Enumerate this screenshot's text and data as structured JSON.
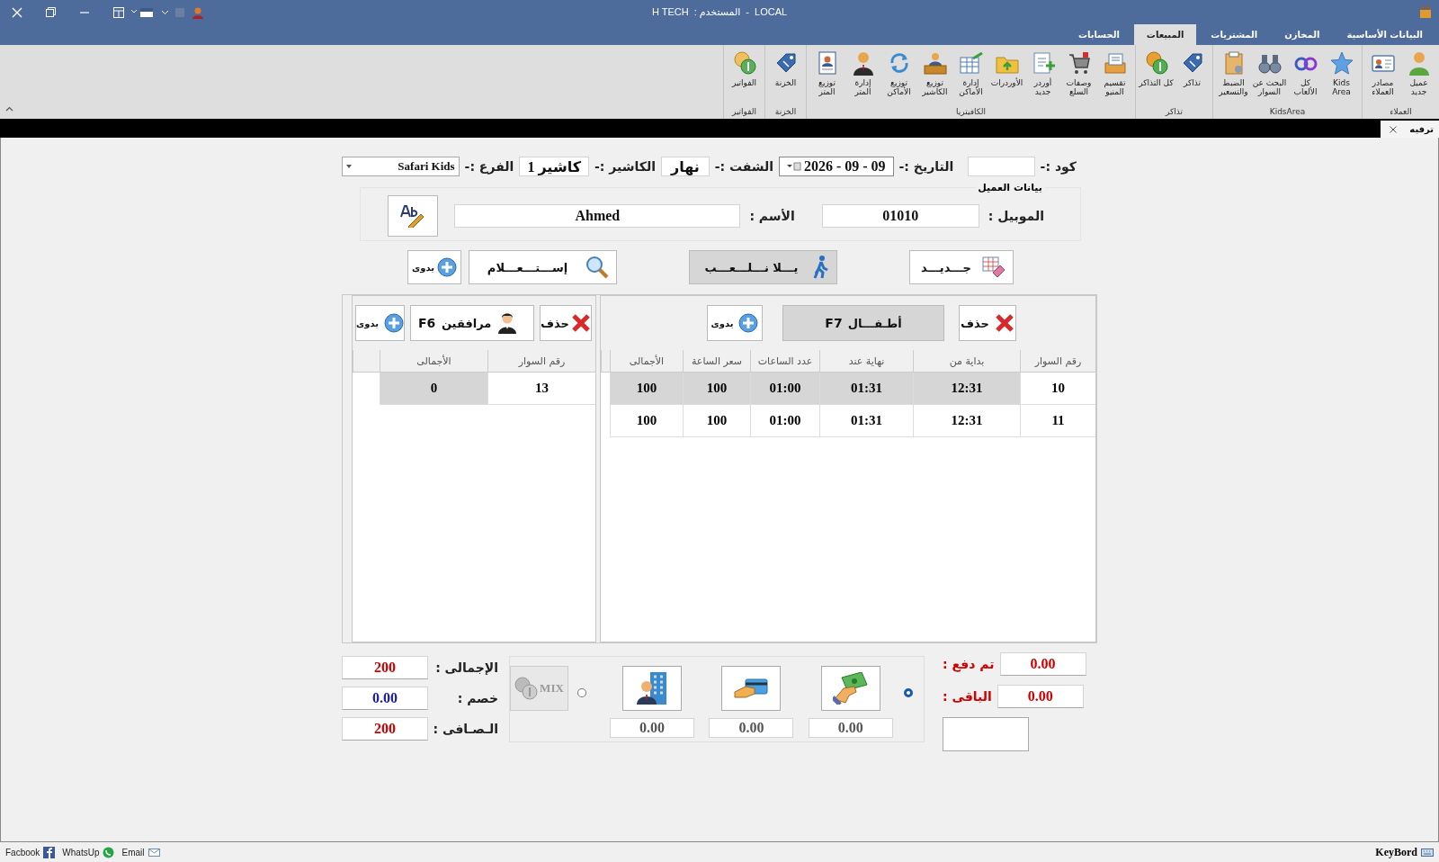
{
  "window": {
    "user": "H TECH",
    "user_label": "المستخدم :",
    "separator": "-",
    "server": "LOCAL"
  },
  "ribbon_tabs": [
    {
      "label": "البيانات الأساسية",
      "selected": false
    },
    {
      "label": "المخازن",
      "selected": false
    },
    {
      "label": "المشتريات",
      "selected": false
    },
    {
      "label": "المبيعات",
      "selected": true
    },
    {
      "label": "الحسابات",
      "selected": false
    }
  ],
  "ribbon_groups": [
    {
      "title": "العملاء",
      "items": [
        "عميل جديد",
        "مصادر العملاء"
      ]
    },
    {
      "title": "KidsArea",
      "items": [
        "Kids Area",
        "كل الألعاب",
        "البحث عن السوار",
        "الضبط والتسعير"
      ]
    },
    {
      "title": "تذاكر",
      "items": [
        "تذاكر",
        "كل التذاكر"
      ]
    },
    {
      "title": "الكافيتريا",
      "items": [
        "تقسيم المنيو",
        "وصفات السلع",
        "أوردر جديد",
        "الأوردرات",
        "إدارة الأماكن",
        "توزيع الكاشير",
        "توزيع الأماكن",
        "إدارة المتر",
        "توزيع المتر"
      ]
    },
    {
      "title": "الخزنة",
      "items": [
        "الخزنة"
      ]
    },
    {
      "title": "الفواتير",
      "items": [
        "الفواتير"
      ]
    }
  ],
  "document_tab": {
    "label": "ترفيه"
  },
  "header": {
    "code_label": "كود :-",
    "date_label": "التاريخ :-",
    "date": "2026 - 09 - 09",
    "shift_label": "الشفت :-",
    "shift": "نهار",
    "cashier_label": "الكاشير :-",
    "cashier": "كاشير 1",
    "branch_label": "الفرع :-",
    "branch": "Safari Kids"
  },
  "customer": {
    "title": "بيانات العميل",
    "mobile_label": "الموبيل :",
    "mobile": "01010",
    "name_label": "الأسم :",
    "name": "Ahmed"
  },
  "actions": [
    {
      "kind": "new",
      "label": "جـــديـــد"
    },
    {
      "kind": "play",
      "label": "يـــلا نـــلـــعـــب"
    },
    {
      "kind": "inquiry",
      "label": "إســـتـــعـــلام"
    },
    {
      "kind": "manual",
      "label": "يدوى"
    }
  ],
  "children_panel": {
    "delete": "حذف",
    "title": "أطـفـــال",
    "hotkey": "F7",
    "manual": "يدوى",
    "columns": [
      "رقم السوار",
      "بداية من",
      "نهاية عند",
      "عدد الساعات",
      "سعر الساعة",
      "الأجمالى"
    ],
    "rows": [
      {
        "selected": true,
        "cells": [
          "10",
          "12:31",
          "01:31",
          "01:00",
          "100",
          "100"
        ]
      },
      {
        "selected": false,
        "cells": [
          "11",
          "12:31",
          "01:31",
          "01:00",
          "100",
          "100"
        ]
      }
    ]
  },
  "companions_panel": {
    "delete": "حذف",
    "title": "مرافقين",
    "hotkey": "F6",
    "manual": "يدوى",
    "columns": [
      "رقم السوار",
      "الأجمالى"
    ],
    "rows": [
      {
        "selected": true,
        "cells": [
          "13",
          "0"
        ]
      }
    ]
  },
  "payment": {
    "paid_label": "تم دفع :",
    "paid": "0.00",
    "remaining_label": "الباقى :",
    "remaining": "0.00",
    "options": [
      {
        "kind": "single",
        "selected": true
      },
      {
        "kind": "mix",
        "selected": false,
        "label": "MIX"
      }
    ],
    "methods": [
      {
        "kind": "cash",
        "value": "0.00"
      },
      {
        "kind": "card",
        "value": "0.00"
      },
      {
        "kind": "bank",
        "value": "0.00"
      }
    ]
  },
  "totals": [
    {
      "kind": "total",
      "label": "الإجمالى :",
      "value": "200"
    },
    {
      "kind": "discount",
      "label": "خصم :",
      "value": "0.00"
    },
    {
      "kind": "net",
      "label": "الـصـافى :",
      "value": "200"
    }
  ],
  "status_bar": {
    "links": [
      {
        "kind": "email",
        "label": "Email"
      },
      {
        "kind": "whatsapp",
        "label": "WhatsUp"
      },
      {
        "kind": "facebook",
        "label": "Facbook"
      }
    ],
    "keyboard": "KeyBord"
  }
}
